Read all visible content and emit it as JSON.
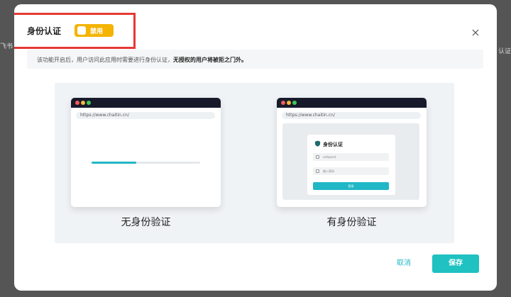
{
  "background": {
    "left_fragment": "飞书",
    "right_fragment": "认证"
  },
  "modal": {
    "title": "身份认证",
    "toggle": {
      "label": "禁用",
      "state": "off",
      "color": "#f4b400"
    },
    "close_icon": "close-icon",
    "notice": {
      "text": "该功能开启后，用户访问此应用时需要进行身份认证，",
      "bold_text": "无授权的用户将被拒之门外。"
    },
    "illustration": {
      "left": {
        "url": "https://www.chaitin.cn/",
        "progress": 0.41,
        "caption": "无身份验证"
      },
      "right": {
        "url": "https://www.chaitin.cn/",
        "login_title": "身份认证",
        "username_placeholder": "safepoint",
        "password_placeholder": "输入密码",
        "login_button": "登录",
        "caption": "有身份验证"
      }
    },
    "footer": {
      "cancel_label": "取消",
      "save_label": "保存"
    },
    "colors": {
      "accent": "#20b7c6",
      "highlight": "#e53935"
    }
  }
}
